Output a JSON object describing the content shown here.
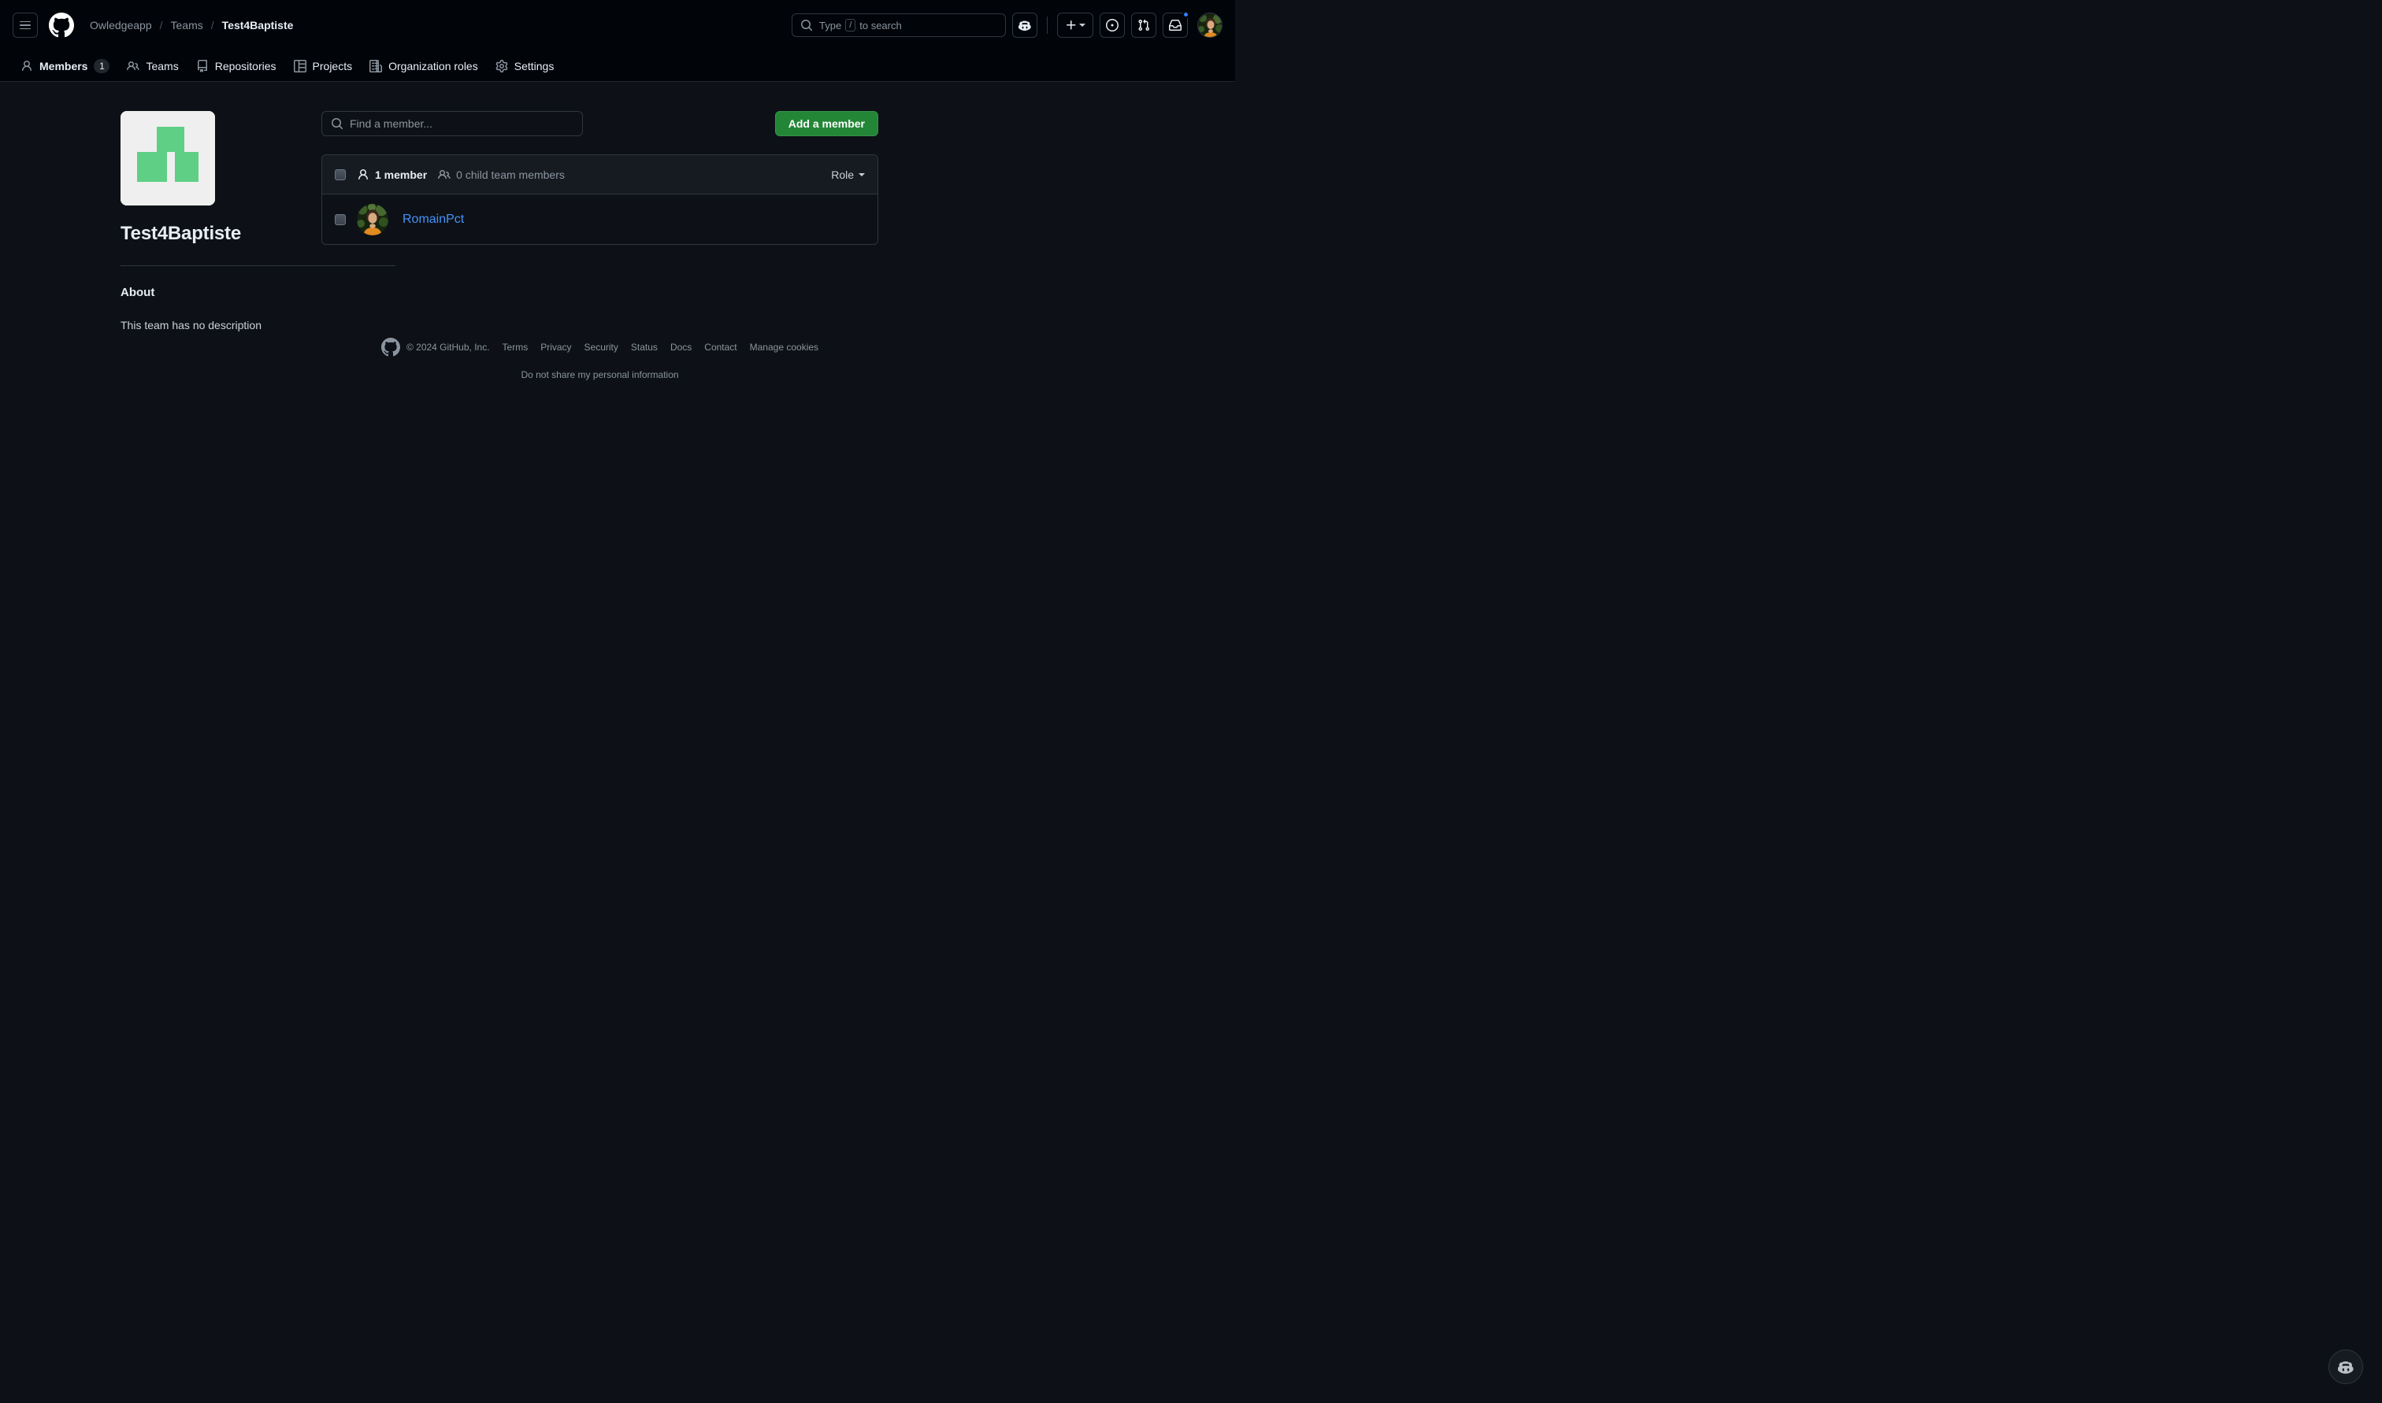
{
  "header": {
    "menu_label": "Open global navigation menu",
    "logo_label": "GitHub homepage",
    "breadcrumb": {
      "org": "Owledgeapp",
      "section": "Teams",
      "current": "Test4Baptiste",
      "separator": "/"
    },
    "search": {
      "prefix": "Type",
      "key": "/",
      "suffix": "to search",
      "full_text": "Type / to search"
    },
    "actions": {
      "copilot": "Copilot",
      "create_new": "Create new...",
      "issues": "Issues",
      "pull_requests": "Pull requests",
      "notifications": "Notifications",
      "profile": "Open user account menu"
    },
    "has_unread_notifications": true
  },
  "nav": {
    "items": [
      {
        "label": "Members",
        "icon": "person-icon",
        "count": "1",
        "active": true
      },
      {
        "label": "Teams",
        "icon": "people-icon",
        "count": null,
        "active": false
      },
      {
        "label": "Repositories",
        "icon": "repo-icon",
        "count": null,
        "active": false
      },
      {
        "label": "Projects",
        "icon": "project-icon",
        "count": null,
        "active": false
      },
      {
        "label": "Organization roles",
        "icon": "organization-icon",
        "count": null,
        "active": false
      },
      {
        "label": "Settings",
        "icon": "gear-icon",
        "count": null,
        "active": false
      }
    ]
  },
  "sidebar": {
    "team_avatar_icon": "team-identicon",
    "team_avatar_bg": "#efefef",
    "team_avatar_fg": "#5fcf86",
    "team_name": "Test4Baptiste",
    "about_heading": "About",
    "about_description": "This team has no description"
  },
  "main": {
    "search": {
      "placeholder": "Find a member...",
      "value": "",
      "icon": "search-icon"
    },
    "add_member_button": "Add a member",
    "list_header": {
      "member_count": "1 member",
      "member_count_icon": "person-icon",
      "child_team_members": "0 child team members",
      "child_team_icon": "people-icon",
      "role_filter": "Role",
      "select_all_label": "Select all members"
    },
    "members": [
      {
        "username": "RomainPct",
        "avatar_alt": "RomainPct avatar",
        "checkbox_label": "Select RomainPct"
      }
    ]
  },
  "footer": {
    "logo_icon": "github-mark-icon",
    "copyright": "© 2024 GitHub, Inc.",
    "links": [
      "Terms",
      "Privacy",
      "Security",
      "Status",
      "Docs",
      "Contact",
      "Manage cookies",
      "Do not share my personal information"
    ]
  },
  "fab": {
    "label": "Copilot",
    "icon": "copilot-icon"
  },
  "colors": {
    "page_bg": "#0d1117",
    "header_bg": "#010409",
    "panel_header_bg": "#161b22",
    "border": "#30363d",
    "accent_green": "#238636",
    "link_blue": "#4493f8",
    "muted_text": "#8b949e",
    "notification_blue": "#2f81f7"
  }
}
